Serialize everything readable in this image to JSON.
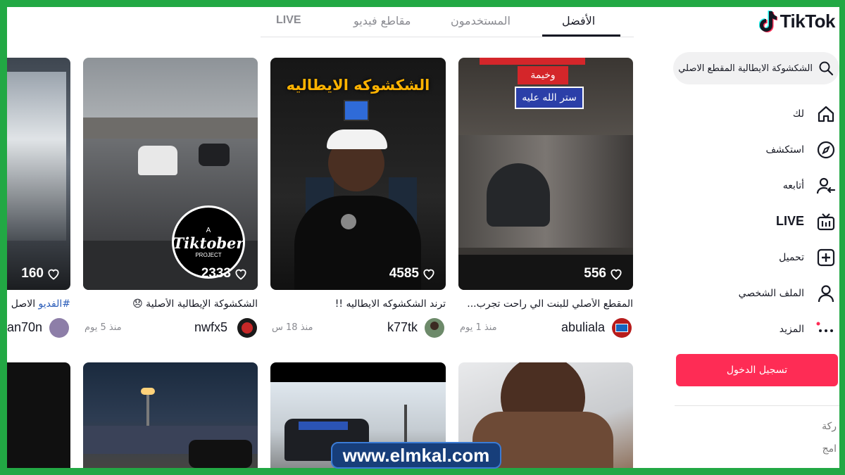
{
  "app": {
    "logo_text": "TikTok"
  },
  "search": {
    "query": "الشكشوكة الايطالية المقطع الاصلي"
  },
  "nav": {
    "items": [
      {
        "label": "لك",
        "icon": "home-icon"
      },
      {
        "label": "استكشف",
        "icon": "compass-icon"
      },
      {
        "label": "أتابعه",
        "icon": "following-icon"
      },
      {
        "label": "LIVE",
        "icon": "live-icon"
      },
      {
        "label": "تحميل",
        "icon": "upload-icon"
      },
      {
        "label": "الملف الشخصي",
        "icon": "profile-icon"
      },
      {
        "label": "المزيد",
        "icon": "more-icon"
      }
    ]
  },
  "login_label": "تسجيل الدخول",
  "footer": {
    "line1": "ركة",
    "line2": "امج"
  },
  "tabs": [
    {
      "label": "الأفضل",
      "active": true
    },
    {
      "label": "المستخدمون",
      "active": false
    },
    {
      "label": "مقاطع فيديو",
      "active": false
    },
    {
      "label": "LIVE",
      "active": false
    }
  ],
  "videos": [
    {
      "likes": "556",
      "overlay": {
        "top": "وخيمة",
        "box": "ستر الله عليه"
      },
      "caption": "المقطع الأصلي للبنت الي راحت تجرب...",
      "user": "abuliala",
      "ago": "منذ 1 يوم"
    },
    {
      "likes": "4585",
      "overlay": {
        "title": "الشكشوكه الايطاليه"
      },
      "caption": "ترند الشكشوكه الايطاليه !!",
      "user": "k77tk",
      "ago": "منذ 18 س"
    },
    {
      "likes": "2333",
      "overlay": {
        "badge_a": "A",
        "badge_main": "Tiktober",
        "badge_sub": "PROJECT"
      },
      "caption": "الشكشوكة الإيطالية الأصلية 😞",
      "user": "nwfx5",
      "ago": "منذ 5 يوم"
    },
    {
      "likes": "160",
      "caption_hashtag": "#الفديو",
      "caption": "الاصل",
      "user": "an70n",
      "ago": ""
    }
  ],
  "watermark": "www.elmkal.com",
  "colors": {
    "accent": "#fe2c55",
    "frame": "#22a844",
    "text": "#161823",
    "muted": "#8a8b91"
  }
}
